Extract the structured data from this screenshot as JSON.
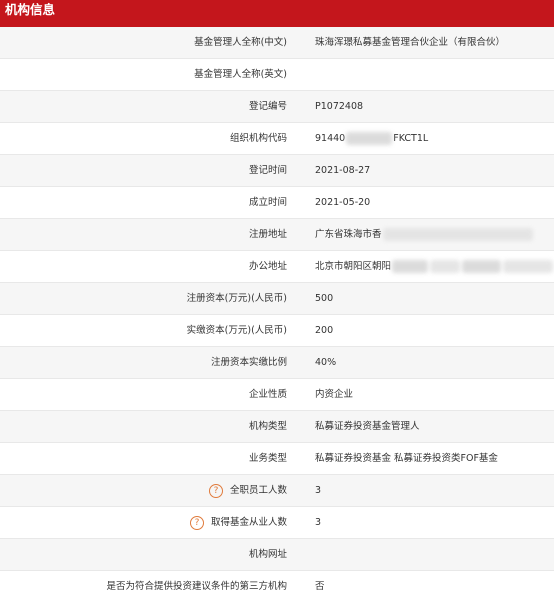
{
  "header": {
    "title": "机构信息"
  },
  "rows": [
    {
      "label": "基金管理人全称(中文)",
      "value": "珠海浑璟私募基金管理合伙企业（有限合伙）"
    },
    {
      "label": "基金管理人全称(英文)",
      "value": ""
    },
    {
      "label": "登记编号",
      "value": "P1072408"
    },
    {
      "label": "组织机构代码",
      "value_prefix": "91440",
      "value_suffix": "FKCT1L"
    },
    {
      "label": "登记时间",
      "value": "2021-08-27"
    },
    {
      "label": "成立时间",
      "value": "2021-05-20"
    },
    {
      "label": "注册地址",
      "value": "广东省珠海市香"
    },
    {
      "label": "办公地址",
      "value": "北京市朝阳区朝阳"
    },
    {
      "label": "注册资本(万元)(人民币)",
      "value": "500"
    },
    {
      "label": "实缴资本(万元)(人民币)",
      "value": "200"
    },
    {
      "label": "注册资本实缴比例",
      "value": "40%"
    },
    {
      "label": "企业性质",
      "value": "内资企业"
    },
    {
      "label": "机构类型",
      "value": "私募证券投资基金管理人"
    },
    {
      "label": "业务类型",
      "value": "私募证券投资基金 私募证券投资类FOF基金"
    },
    {
      "label": "全职员工人数",
      "value": "3",
      "help": "?"
    },
    {
      "label": "取得基金从业人数",
      "value": "3",
      "help": "?"
    },
    {
      "label": "机构网址",
      "value": ""
    },
    {
      "label": "是否为符合提供投资建议条件的第三方机构",
      "value": "否"
    }
  ]
}
